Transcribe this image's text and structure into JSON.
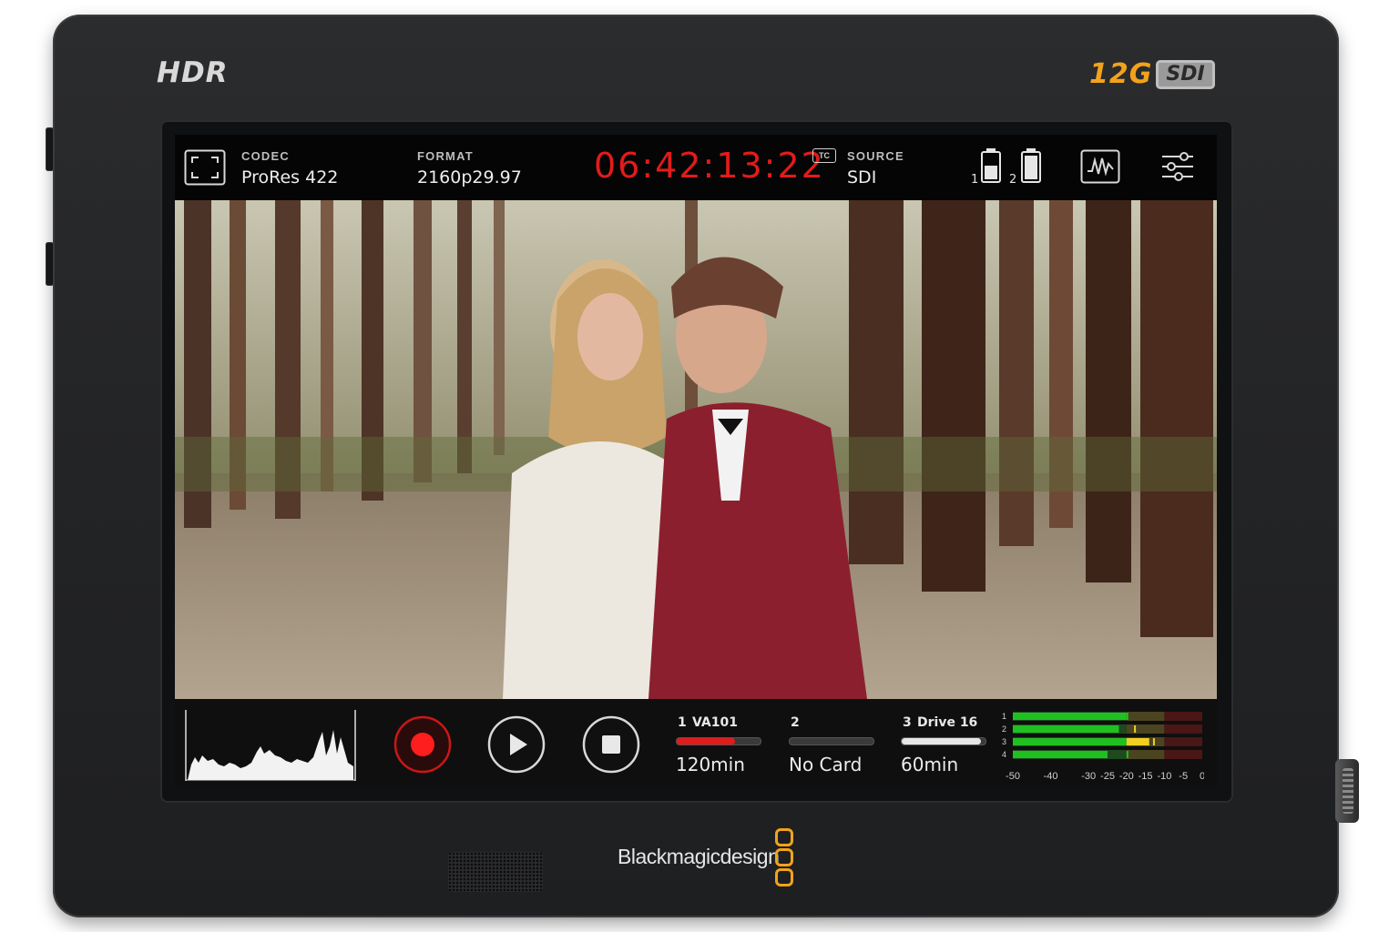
{
  "device": {
    "hdr_logo": "HDR",
    "sdi_logo_prefix": "12G",
    "sdi_logo_suffix": "SDI",
    "brand": "Blackmagicdesign"
  },
  "topbar": {
    "codec_label": "CODEC",
    "codec_value": "ProRes 422",
    "format_label": "FORMAT",
    "format_value": "2160p29.97",
    "timecode": "06:42:13:22",
    "tc_badge": "TC",
    "source_label": "SOURCE",
    "source_value": "SDI",
    "battery_1_label": "1",
    "battery_2_label": "2"
  },
  "controls": {
    "record_icon": "record-icon",
    "play_icon": "play-icon",
    "stop_icon": "stop-icon"
  },
  "slots": [
    {
      "number": "1",
      "name": "VA101",
      "remaining": "120min",
      "fill": 0.7,
      "color": "#e31b1b"
    },
    {
      "number": "2",
      "name": "",
      "remaining": "No Card",
      "fill": 0.0,
      "color": "#888888"
    },
    {
      "number": "3",
      "name": "Drive 16",
      "remaining": "60min",
      "fill": 0.95,
      "color": "#e6e6e6"
    }
  ],
  "audio_meters": {
    "channels": [
      "1",
      "2",
      "3",
      "4"
    ],
    "scale": [
      "-50",
      "-40",
      "-30",
      "-25",
      "-20",
      "-15",
      "-10",
      "-5",
      "0"
    ],
    "levels_db": [
      -20,
      -22,
      -14,
      -25
    ],
    "peaks_db": [
      -20,
      -18,
      -13,
      -20
    ],
    "colors": {
      "green": "#20c020",
      "yellow": "#f0d020",
      "red": "#c01818"
    }
  },
  "colors": {
    "timecode_red": "#e31b1b",
    "accent_orange": "#f2a31b"
  }
}
